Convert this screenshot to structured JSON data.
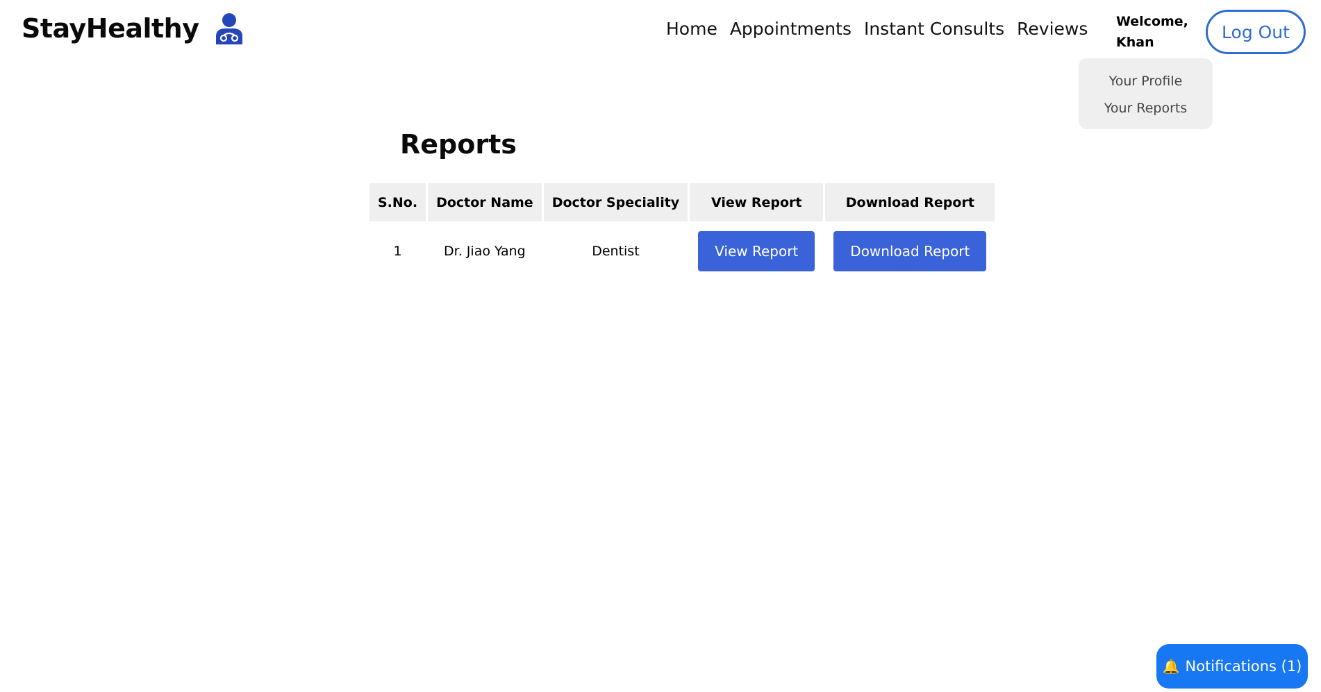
{
  "brand": {
    "name": "StayHealthy",
    "icon": "doctor-icon"
  },
  "nav": {
    "links": [
      "Home",
      "Appointments",
      "Instant Consults",
      "Reviews"
    ],
    "welcome": "Welcome, Khan",
    "logout_label": "Log Out"
  },
  "dropdown": {
    "items": [
      "Your Profile",
      "Your Reports"
    ]
  },
  "main": {
    "title": "Reports",
    "table": {
      "headers": [
        "S.No.",
        "Doctor Name",
        "Doctor Speciality",
        "View Report",
        "Download Report"
      ],
      "rows": [
        {
          "sno": "1",
          "doctor": "Dr. Jiao Yang",
          "speciality": "Dentist",
          "view_label": "View Report",
          "download_label": "Download Report"
        }
      ]
    }
  },
  "notifications": {
    "label": "Notifications (1)",
    "icon": "bell-icon"
  },
  "colors": {
    "accent": "#3a63d9",
    "notif": "#1877f2",
    "outline": "#2f6cd1",
    "header_bg": "#efefef"
  }
}
